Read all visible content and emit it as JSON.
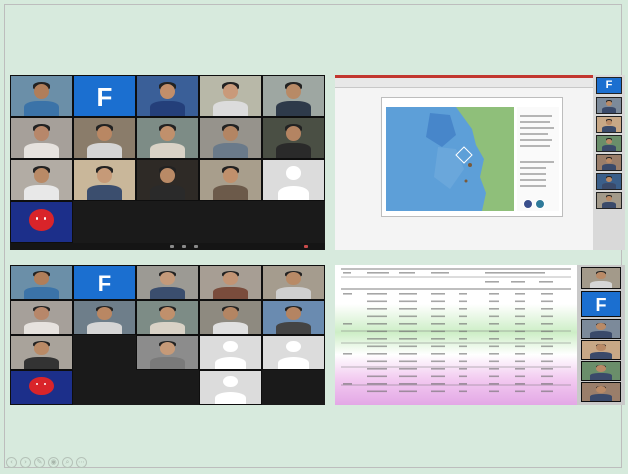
{
  "panels": {
    "top_left": {
      "tile_letter": "F"
    },
    "top_right": {
      "app_ribbon_color": "#c2372f",
      "map_title": "",
      "legend_title": "",
      "thumb_letter": "F"
    },
    "bottom_left": {
      "tile_letter": "F"
    },
    "bottom_right": {
      "thumb_letter": "F"
    }
  },
  "bottom_toolbar": {
    "icons": [
      "left-arrow-icon",
      "right-arrow-icon",
      "pencil-icon",
      "view-icon",
      "zoom-icon",
      "more-icon"
    ],
    "glyphs": [
      "‹",
      "›",
      "✎",
      "◉",
      "⌕",
      "⋯"
    ]
  },
  "colors": {
    "page_background": "#d6eadc",
    "tile_blue": "#1b6fd0",
    "call_background": "#1a1a1a"
  }
}
